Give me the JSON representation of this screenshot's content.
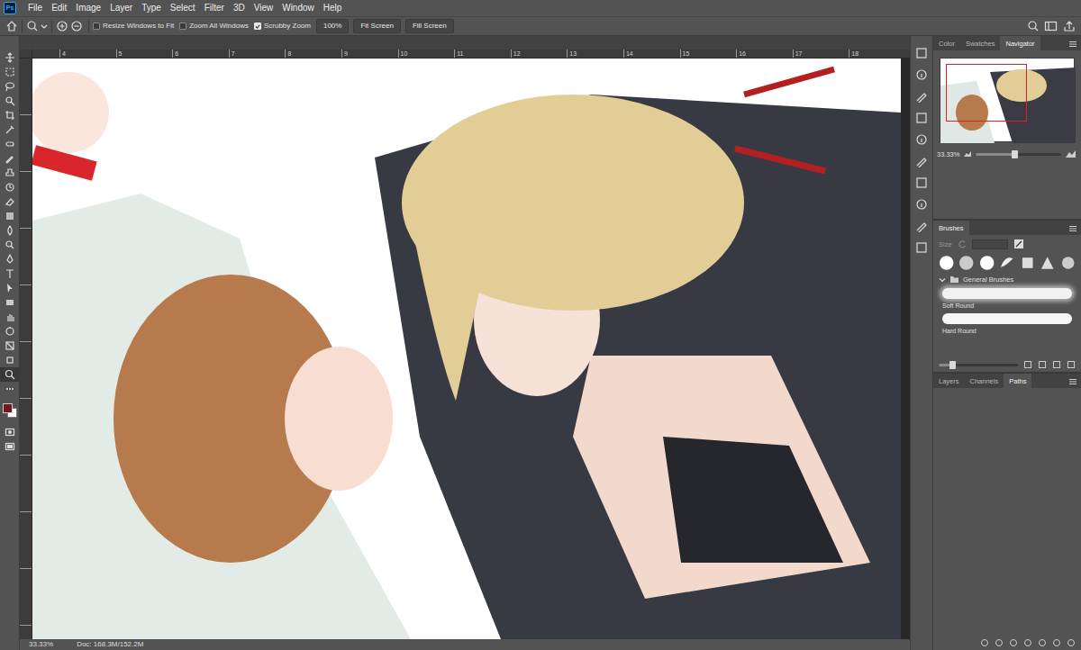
{
  "app": {
    "logo": "Ps"
  },
  "menu": [
    "File",
    "Edit",
    "Image",
    "Layer",
    "Type",
    "Select",
    "Filter",
    "3D",
    "View",
    "Window",
    "Help"
  ],
  "options": {
    "checkboxes": [
      {
        "label": "Resize Windows to Fit",
        "checked": false
      },
      {
        "label": "Zoom All Windows",
        "checked": false
      },
      {
        "label": "Scrubby Zoom",
        "checked": true
      }
    ],
    "buttons": [
      "100%",
      "Fit Screen",
      "Fill Screen"
    ]
  },
  "tools": [
    {
      "selected": false
    },
    {
      "selected": false
    },
    {
      "selected": false
    },
    {
      "selected": false
    },
    {
      "selected": false
    },
    {
      "selected": false
    },
    {
      "selected": false
    },
    {
      "selected": false
    },
    {
      "selected": false
    },
    {
      "selected": false
    },
    {
      "selected": false
    },
    {
      "selected": false
    },
    {
      "selected": false
    },
    {
      "selected": false
    },
    {
      "selected": false
    },
    {
      "selected": false
    },
    {
      "selected": false
    },
    {
      "selected": false
    },
    {
      "selected": false
    },
    {
      "selected": false
    },
    {
      "selected": false
    },
    {
      "selected": false
    },
    {
      "selected": true
    },
    {
      "selected": false
    }
  ],
  "colors": {
    "foreground": "#6e1818",
    "background": "#ffffff"
  },
  "ruler": {
    "top": [
      "4",
      "5",
      "6",
      "7",
      "8",
      "9",
      "10",
      "11",
      "12",
      "13",
      "14",
      "15",
      "16",
      "17",
      "18"
    ]
  },
  "status": {
    "zoom": "33.33%",
    "doc": "Doc: 168.3M/152.2M"
  },
  "navigator": {
    "tabs": [
      {
        "label": "Color",
        "selected": false
      },
      {
        "label": "Swatches",
        "selected": false
      },
      {
        "label": "Navigator",
        "selected": true
      }
    ],
    "zoom": "33.33%",
    "level": 0.45
  },
  "brushes": {
    "tab": "Brushes",
    "size_label": "Size",
    "folder": "General Brushes",
    "expanded": true,
    "presets": [
      "Soft Round",
      "Hard Round"
    ],
    "preview_level": 0.17
  },
  "layers": {
    "tabs": [
      {
        "label": "Layers",
        "selected": false
      },
      {
        "label": "Channels",
        "selected": false
      },
      {
        "label": "Paths",
        "selected": true
      }
    ]
  }
}
